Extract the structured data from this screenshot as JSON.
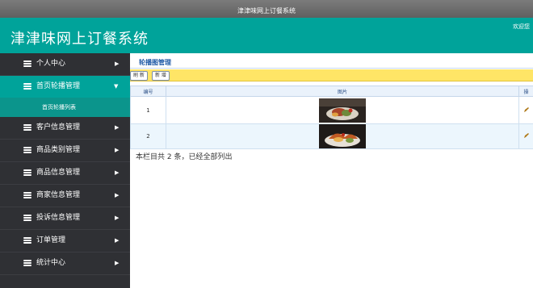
{
  "window": {
    "title": "津津味网上订餐系统"
  },
  "header": {
    "app_title": "津津味网上订餐系统",
    "welcome": "欢迎您"
  },
  "sidebar": {
    "items": [
      {
        "label": "个人中心",
        "arrow": "▶"
      },
      {
        "label": "首页轮播管理",
        "arrow": "▼",
        "active": true
      },
      {
        "label": "客户信息管理",
        "arrow": "▶"
      },
      {
        "label": "商品类别管理",
        "arrow": "▶"
      },
      {
        "label": "商品信息管理",
        "arrow": "▶"
      },
      {
        "label": "商家信息管理",
        "arrow": "▶"
      },
      {
        "label": "投诉信息管理",
        "arrow": "▶"
      },
      {
        "label": "订单管理",
        "arrow": "▶"
      },
      {
        "label": "统计中心",
        "arrow": "▶"
      }
    ],
    "sub_items": [
      {
        "label": "首页轮播列表"
      }
    ]
  },
  "main": {
    "title": "轮播图管理",
    "toolbar": {
      "refresh_label": "刷 新",
      "add_label": "新 增"
    },
    "table": {
      "columns": [
        "编号",
        "图片",
        "操"
      ],
      "rows": [
        {
          "id": "1",
          "image": "food-photo-1"
        },
        {
          "id": "2",
          "image": "food-photo-2"
        }
      ]
    },
    "footer_text": "本栏目共 2 条，已经全部列出"
  },
  "colors": {
    "accent": "#00a39a",
    "sidebar_bg": "#2f3034",
    "toolbar_bg": "#ffe566"
  }
}
